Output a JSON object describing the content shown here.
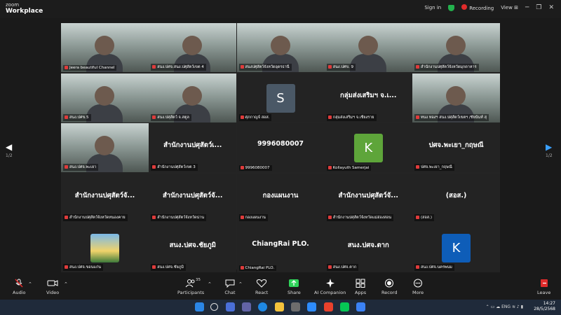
{
  "app": {
    "logo_top": "zoom",
    "logo_bottom": "Workplace"
  },
  "titlebar": {
    "sign_in": "Sign in",
    "recording": "Recording",
    "view": "View"
  },
  "pager": {
    "left": "1/2",
    "right": "1/2"
  },
  "tiles": [
    {
      "name": "Jeera beautiful Channel",
      "video": true,
      "active": true
    },
    {
      "name": "สนง.ปศจ.สนง.ปศุสัตว์เขต 4",
      "video": true
    },
    {
      "name": "สนงปศุสัตว์จังหวัดอุดรธานี",
      "video": true
    },
    {
      "name": "สนง.ปศข. 9",
      "video": true
    },
    {
      "name": "สำนักงานปศุสัตว์จังหวัดมุกดาหาร",
      "video": true
    },
    {
      "name": "สนง.ปศข.5",
      "video": true
    },
    {
      "name": "สนง.ปศุสัตว์ จ.สตูล",
      "video": true
    },
    {
      "name": "ศุภกาญจ์ สอส.",
      "avatar": "S",
      "avatar_color": "#4a5866"
    },
    {
      "big": "กลุ่มส่งเสริมฯ จ.เ...",
      "name": "กลุ่มส่งเสริมฯ จ.เชียงราย"
    },
    {
      "name": "ทนง ทองฯ สนง.ปศุสัตว์เขตฯ /ชัยนันท์ สุ",
      "video": true
    },
    {
      "name": "สนง.ปศจ.พะเยา",
      "video": true
    },
    {
      "big": "สำนักงานปศุสัตว์เ...",
      "name": "สำนักงานปศุสัตว์เขต 3"
    },
    {
      "big": "9996080007",
      "name": "9996080007"
    },
    {
      "name": "Kollayuth Samerjai",
      "avatar": "K",
      "avatar_color": "#5ea53a"
    },
    {
      "big": "ปศจ.พะเยา_กฤษณี",
      "name": "ปศจ.พะเยา_กฤษณี"
    },
    {
      "big": "สำนักงานปศุสัตว์จั...",
      "name": "สำนักงานปศุสัตว์จังหวัดหนองคาย"
    },
    {
      "big": "สำนักงานปศุสัตว์จั...",
      "name": "สำนักงานปศุสัตว์จังหวัดน่าน"
    },
    {
      "big": "กองแผนงาน",
      "name": "กองแผนงาน"
    },
    {
      "big": "สำนักงานปศุสัตว์จั...",
      "name": "สำนักงานปศุสัตว์จังหวัดแม่ฮ่องสอน"
    },
    {
      "big": "(สอส.)",
      "name": "(สอส.)"
    },
    {
      "name": "สนง.ปศจ.ขอนแก่น",
      "picture": true
    },
    {
      "big": "สนง.ปศจ.ชัยภูมิ",
      "name": "สนง.ปศจ.ชัยภูมิ"
    },
    {
      "big": "ChiangRai PLO.",
      "name": "ChiangRai PLO."
    },
    {
      "big": "สนง.ปศจ.ตาก",
      "name": "สนง.ปศจ.ตาก"
    },
    {
      "name": "สนง.ปศจ.นครพนม",
      "avatar": "K",
      "avatar_color": "#0e5db8"
    }
  ],
  "controls": {
    "audio": "Audio",
    "video": "Video",
    "participants": "Participants",
    "participants_count": "35",
    "chat": "Chat",
    "react": "React",
    "share": "Share",
    "ai_companion": "AI Companion",
    "apps": "Apps",
    "record": "Record",
    "more": "More",
    "leave": "Leave"
  },
  "taskbar": {
    "lang": "ENG",
    "time": "14:27",
    "date": "28/5/2568"
  },
  "colors": {
    "share": "#2fd35a",
    "leave": "#e02b2b",
    "active_outline": "#2fd35a"
  }
}
